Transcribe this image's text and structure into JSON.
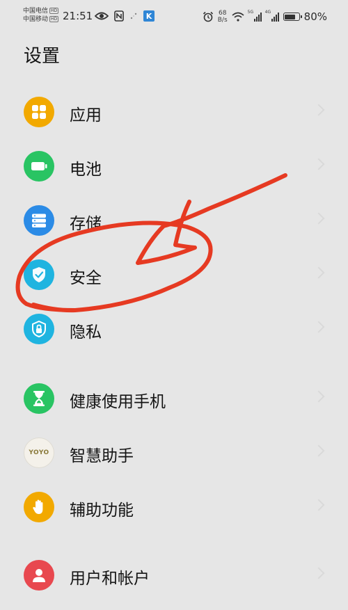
{
  "status_bar": {
    "carrier_1": "中国电信",
    "carrier_2": "中国移动",
    "hd_badge": "HD",
    "time": "21:51",
    "net_speed_value": "68",
    "net_speed_unit": "B/s",
    "sig1_label": "5G",
    "sig2_label": "4G",
    "battery_percent": "80%",
    "battery_level": 0.8,
    "app_badge": "K"
  },
  "page": {
    "title": "设置"
  },
  "settings_items": [
    {
      "label": "应用",
      "color": "#f2a900",
      "icon": "apps-icon"
    },
    {
      "label": "电池",
      "color": "#29c463",
      "icon": "battery-icon"
    },
    {
      "label": "存储",
      "color": "#2b8be6",
      "icon": "storage-icon"
    },
    {
      "label": "安全",
      "color": "#1fb4e0",
      "icon": "shield-icon"
    },
    {
      "label": "隐私",
      "color": "#1fb4e0",
      "icon": "privacy-lock-icon"
    },
    {
      "label": "健康使用手机",
      "color": "#29c463",
      "icon": "hourglass-icon"
    },
    {
      "label": "智慧助手",
      "color": "#f4f1ea",
      "icon": "yoyo-icon",
      "icon_text": "YOYO"
    },
    {
      "label": "辅助功能",
      "color": "#f2a900",
      "icon": "hand-icon"
    },
    {
      "label": "用户和帐户",
      "color": "#e8484f",
      "icon": "user-icon"
    }
  ],
  "annotation": {
    "color": "#e63a22"
  }
}
